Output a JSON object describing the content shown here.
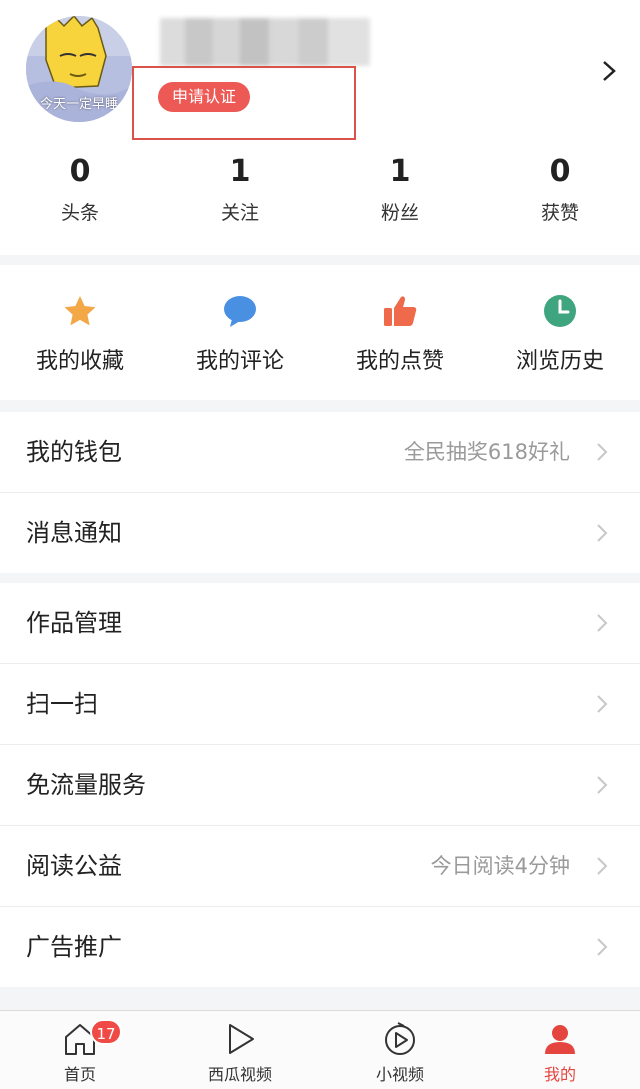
{
  "profile": {
    "avatar_caption": "今天一定早睡",
    "verify_badge": "申请认证"
  },
  "stats": [
    {
      "value": "0",
      "label": "头条"
    },
    {
      "value": "1",
      "label": "关注"
    },
    {
      "value": "1",
      "label": "粉丝"
    },
    {
      "value": "0",
      "label": "获赞"
    }
  ],
  "quick_actions": [
    {
      "label": "我的收藏",
      "icon": "star-icon",
      "color": "#f3a847"
    },
    {
      "label": "我的评论",
      "icon": "comment-icon",
      "color": "#4a90e2"
    },
    {
      "label": "我的点赞",
      "icon": "thumbs-up-icon",
      "color": "#ef6a4a"
    },
    {
      "label": "浏览历史",
      "icon": "clock-icon",
      "color": "#3fa57f"
    }
  ],
  "menu_group1": [
    {
      "label": "我的钱包",
      "hint": "全民抽奖618好礼"
    },
    {
      "label": "消息通知",
      "hint": ""
    }
  ],
  "menu_group2": [
    {
      "label": "作品管理",
      "hint": ""
    },
    {
      "label": "扫一扫",
      "hint": ""
    },
    {
      "label": "免流量服务",
      "hint": ""
    },
    {
      "label": "阅读公益",
      "hint": "今日阅读4分钟"
    },
    {
      "label": "广告推广",
      "hint": ""
    }
  ],
  "tabbar": {
    "home": {
      "label": "首页",
      "badge": "17"
    },
    "xigua": {
      "label": "西瓜视频"
    },
    "shortvideo": {
      "label": "小视频"
    },
    "me": {
      "label": "我的"
    }
  },
  "colors": {
    "accent": "#e4463f",
    "badge": "#ed5a55"
  }
}
